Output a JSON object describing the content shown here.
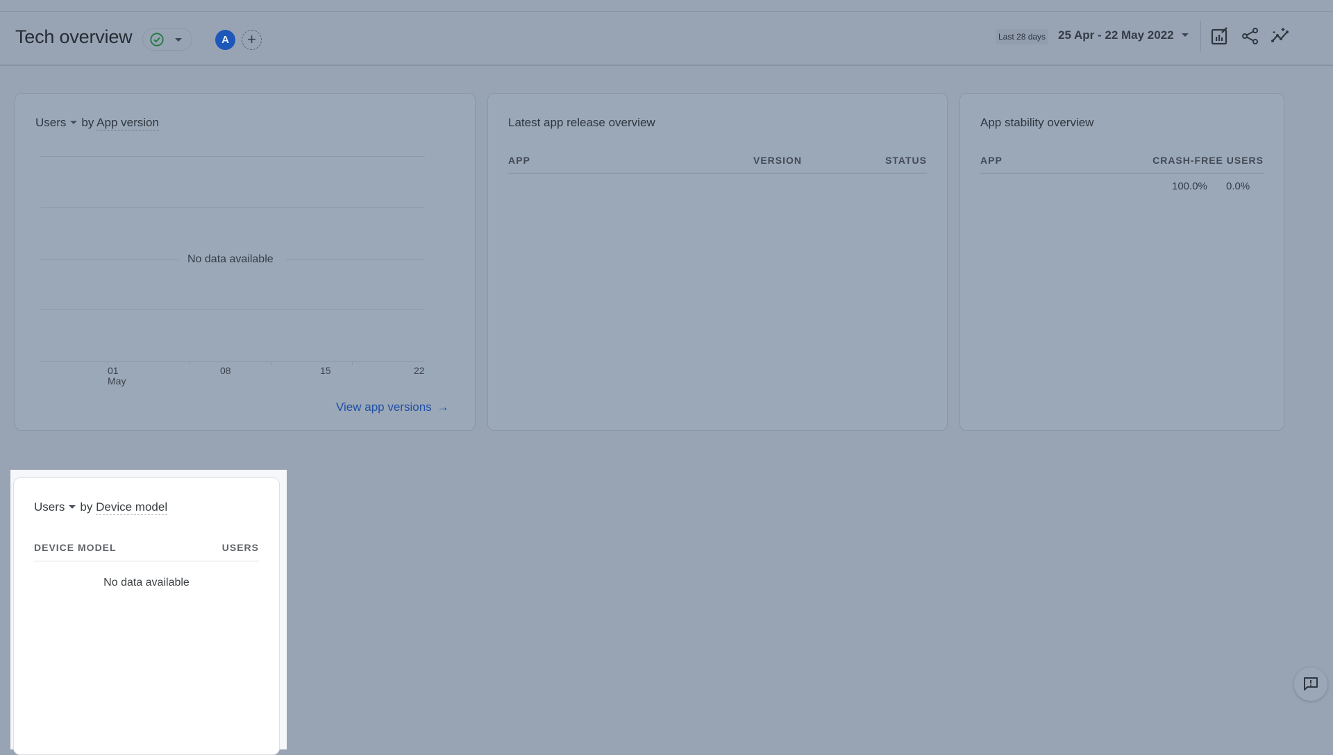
{
  "header": {
    "title": "Tech overview",
    "status_icon": "check-circle-icon",
    "avatar_initial": "A",
    "add_avatar_symbol": "+",
    "date_label": "Last 28 days",
    "date_range": "25 Apr - 22 May 2022",
    "icons": [
      "customize-report-icon",
      "share-icon",
      "insights-icon"
    ]
  },
  "colors": {
    "accent": "#1a56b8",
    "status_ok": "#1e8e3e",
    "link": "#1f4fa6",
    "overlay_bg": "#98a4b3"
  },
  "cards": {
    "app_version": {
      "metric": "Users",
      "dimension_prefix": "by",
      "dimension": "App version",
      "no_data": "No data available",
      "link": "View app versions",
      "link_arrow": "→"
    },
    "latest_release": {
      "title": "Latest app release overview",
      "columns": [
        "APP",
        "VERSION",
        "STATUS"
      ]
    },
    "stability": {
      "title": "App stability overview",
      "columns": [
        "APP",
        "CRASH-FREE USERS"
      ],
      "values": [
        "100.0%",
        "0.0%"
      ]
    },
    "device_model": {
      "metric": "Users",
      "dimension_prefix": "by",
      "dimension": "Device model",
      "columns": [
        "DEVICE MODEL",
        "USERS"
      ],
      "no_data": "No data available"
    }
  },
  "chart_data": {
    "type": "line",
    "title": "Users by App version",
    "x": [
      "01 May",
      "08",
      "15",
      "22"
    ],
    "x_tick_labels": [
      {
        "day": "01",
        "month": "May"
      },
      {
        "day": "08"
      },
      {
        "day": "15"
      },
      {
        "day": "22"
      }
    ],
    "series": [],
    "xlabel": "",
    "ylabel": "",
    "grid": true,
    "annotation": "No data available"
  }
}
